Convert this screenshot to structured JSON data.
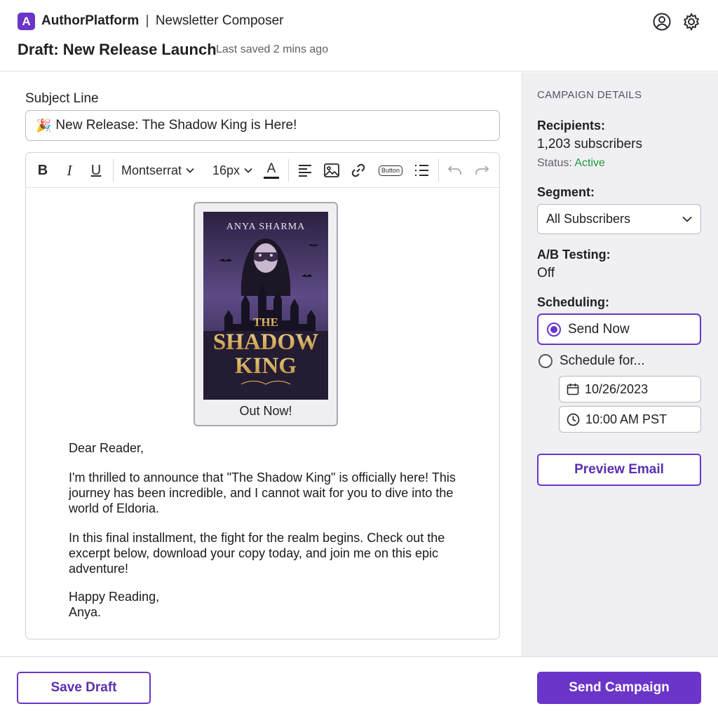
{
  "header": {
    "logo_letter": "A",
    "brand": "AuthorPlatform",
    "separator": "|",
    "section": "Newsletter Composer",
    "draft_title": "Draft: New Release Launch",
    "last_saved": "Last saved 2 mins ago",
    "icons": [
      "user-circle-icon",
      "gear-icon"
    ]
  },
  "editor": {
    "subject_label": "Subject Line",
    "subject_emoji": "🎉",
    "subject_value": "New Release: The Shadow King is Here!",
    "toolbar": {
      "bold": "B",
      "italic": "I",
      "underline": "U",
      "font_family": "Montserrat",
      "font_size": "16px",
      "text_color_glyph": "A",
      "button_glyph": "Button",
      "icons": [
        "align-left-icon",
        "image-icon",
        "link-icon",
        "button-block-icon",
        "list-icon",
        "undo-icon",
        "redo-icon"
      ]
    },
    "cover": {
      "author": "ANYA SHARMA",
      "title_line1": "THE",
      "title_line2": "SHADOW",
      "title_line3": "KING",
      "caption": "Out Now!"
    },
    "letter": {
      "greeting": "Dear Reader,",
      "paragraph1": "I'm thrilled to announce that \"The Shadow King\" is officially here! This journey has been incredible, and I cannot wait for you to dive into the world of Eldoria.",
      "paragraph2": "In this final installment, the fight for the realm begins. Check out the excerpt below, download your copy today, and join me on this epic adventure!",
      "signoff1": "Happy Reading,",
      "signoff2": "Anya."
    }
  },
  "sidebar": {
    "heading": "CAMPAIGN DETAILS",
    "recipients_label": "Recipients:",
    "recipients_value": "1,203 subscribers",
    "status_prefix": "Status:",
    "status_value": "Active",
    "status_color": "#1f9a3a",
    "segment_label": "Segment:",
    "segment_value": "All Subscribers",
    "ab_label": "A/B Testing:",
    "ab_value": "Off",
    "scheduling_label": "Scheduling:",
    "send_now": "Send Now",
    "schedule_for": "Schedule for...",
    "date": "10/26/2023",
    "time": "10:00 AM PST",
    "preview_button": "Preview Email"
  },
  "footer": {
    "save_draft": "Save Draft",
    "send_campaign": "Send Campaign"
  },
  "colors": {
    "accent": "#6a35c8",
    "sidebar_bg": "#f0f0f4"
  }
}
